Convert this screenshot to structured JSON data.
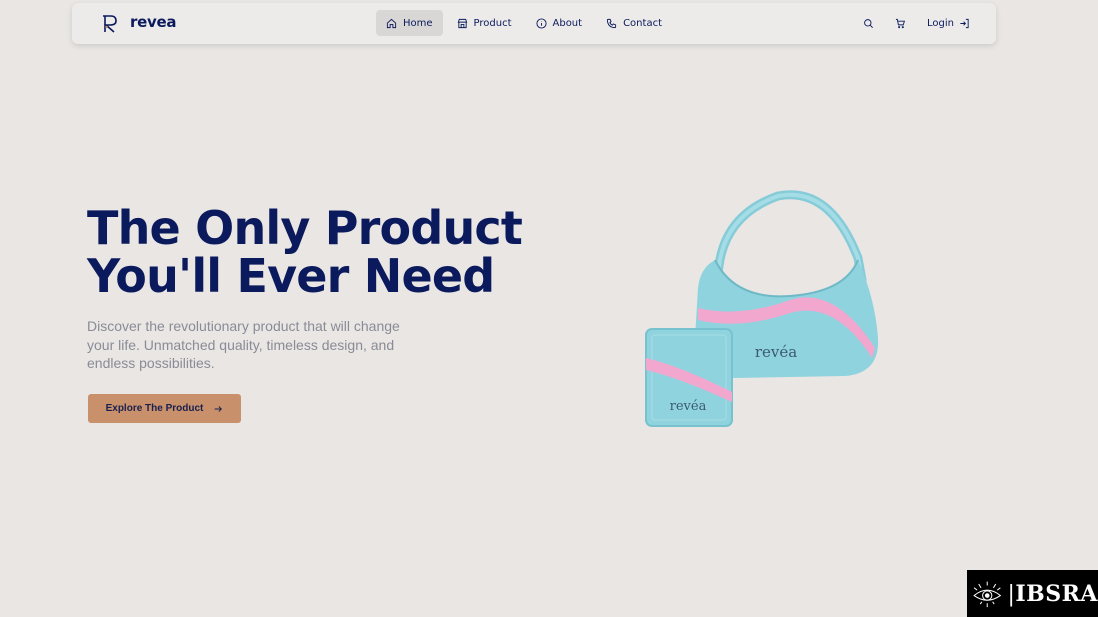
{
  "brand": {
    "name": "revea",
    "logo_letter": "R"
  },
  "nav": {
    "items": [
      {
        "label": "Home",
        "icon": "home-icon",
        "active": true
      },
      {
        "label": "Product",
        "icon": "store-icon",
        "active": false
      },
      {
        "label": "About",
        "icon": "info-icon",
        "active": false
      },
      {
        "label": "Contact",
        "icon": "phone-icon",
        "active": false
      }
    ],
    "search_icon": "search-icon",
    "cart_icon": "cart-icon",
    "login_label": "Login",
    "login_icon": "login-icon"
  },
  "hero": {
    "title_line1": "The Only Product",
    "title_line2": "You'll Ever Need",
    "description": "Discover the revolutionary product that will change your life. Unmatched quality, timeless design, and endless possibilities.",
    "cta_label": "Explore The Product",
    "cta_icon": "arrow-right-icon"
  },
  "product_image": {
    "bag_label": "revéa",
    "wallet_label": "revéa"
  },
  "watermark": {
    "text": "IBSRA"
  },
  "colors": {
    "background": "#e9e6e4",
    "navbar": "#edebea",
    "primary_text": "#0b1a5c",
    "muted_text": "#8a8b96",
    "cta": "#c8916b",
    "product_blue": "#8fd3de",
    "product_pink": "#f2a7cf"
  }
}
